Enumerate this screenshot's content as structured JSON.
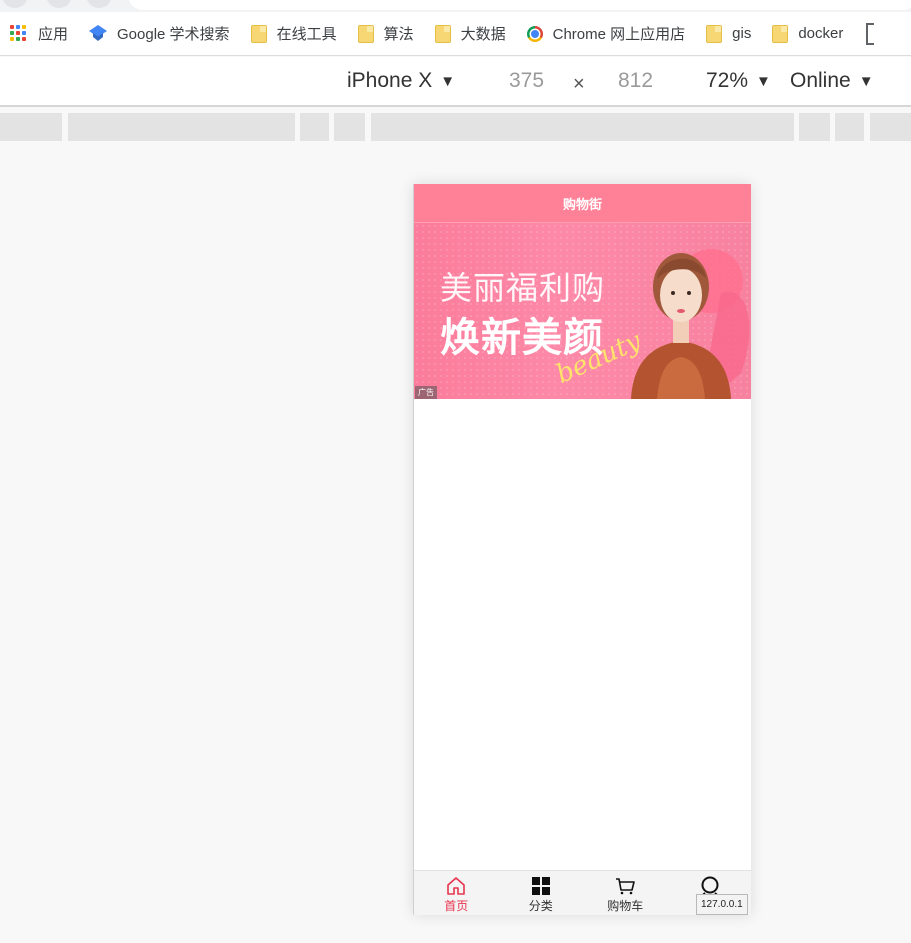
{
  "browser": {
    "bookmarks": [
      {
        "label": "应用",
        "icon": "apps-grid-icon"
      },
      {
        "label": "Google 学术搜索",
        "icon": "scholar-icon"
      },
      {
        "label": "在线工具",
        "icon": "folder-icon"
      },
      {
        "label": "算法",
        "icon": "folder-icon"
      },
      {
        "label": "大数据",
        "icon": "folder-icon"
      },
      {
        "label": "Chrome 网上应用店",
        "icon": "chrome-store-icon"
      },
      {
        "label": "gis",
        "icon": "folder-icon"
      },
      {
        "label": "docker",
        "icon": "folder-icon"
      }
    ]
  },
  "devtools": {
    "device": "iPhone X",
    "width": "375",
    "times": "×",
    "height": "812",
    "zoom": "72%",
    "network": "Online"
  },
  "app": {
    "header_title": "购物街",
    "banner": {
      "line1": "美丽福利购",
      "line2": "焕新美颜",
      "script": "beauty",
      "ad_tag": "广告"
    },
    "tabs": [
      {
        "label": "首页",
        "icon": "home-icon",
        "active": true
      },
      {
        "label": "分类",
        "icon": "category-grid-icon",
        "active": false
      },
      {
        "label": "购物车",
        "icon": "cart-icon",
        "active": false
      },
      {
        "label": "",
        "icon": "profile-icon",
        "active": false
      }
    ],
    "status_url": "127.0.0.1"
  },
  "colors": {
    "accent": "#ff8197",
    "active_tab": "#e8344e",
    "page_bg": "#f8f8f8"
  }
}
